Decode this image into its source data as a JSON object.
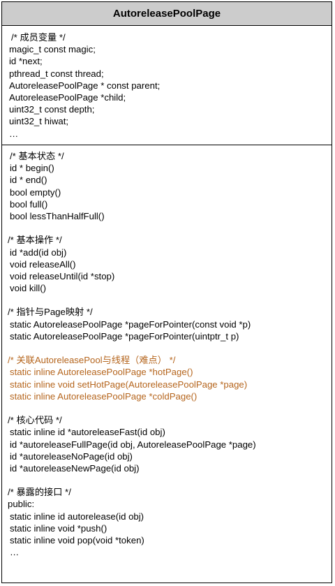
{
  "class_name": "AutoreleasePoolPage",
  "accent_color": "#b5651d",
  "fields": [
    "/* 成员变量 */",
    "magic_t const magic;",
    "id *next;",
    "pthread_t const thread;",
    "AutoreleasePoolPage * const parent;",
    "AutoreleasePoolPage *child;",
    "uint32_t const depth;",
    "uint32_t hiwat;",
    "…"
  ],
  "groups": [
    {
      "comment": "/* 基本状态 */",
      "lines": [
        "id * begin()",
        "id * end()",
        "bool empty()",
        "bool full()",
        "bool lessThanHalfFull()"
      ]
    },
    {
      "comment": "/* 基本操作 */",
      "lines": [
        "id *add(id obj)",
        "void releaseAll()",
        "void releaseUntil(id *stop)",
        "void kill()"
      ]
    },
    {
      "comment": "/* 指针与Page映射 */",
      "lines": [
        "static AutoreleasePoolPage *pageForPointer(const void *p)",
        "static AutoreleasePoolPage *pageForPointer(uintptr_t p)"
      ]
    },
    {
      "comment": "/* 关联AutoreleasePool与线程（难点） */",
      "highlight": true,
      "lines": [
        "static inline AutoreleasePoolPage *hotPage()",
        "static inline void setHotPage(AutoreleasePoolPage *page)",
        "static inline AutoreleasePoolPage *coldPage()"
      ]
    },
    {
      "comment": "/* 核心代码 */",
      "lines": [
        "static inline id *autoreleaseFast(id obj)",
        "id *autoreleaseFullPage(id obj, AutoreleasePoolPage *page)",
        "id *autoreleaseNoPage(id obj)",
        "id *autoreleaseNewPage(id obj)"
      ]
    },
    {
      "comment": "/* 暴露的接口 */",
      "lines": [
        "public:",
        "static inline id autorelease(id obj)",
        "static inline void *push()",
        "static inline void pop(void *token)",
        "…"
      ]
    }
  ]
}
